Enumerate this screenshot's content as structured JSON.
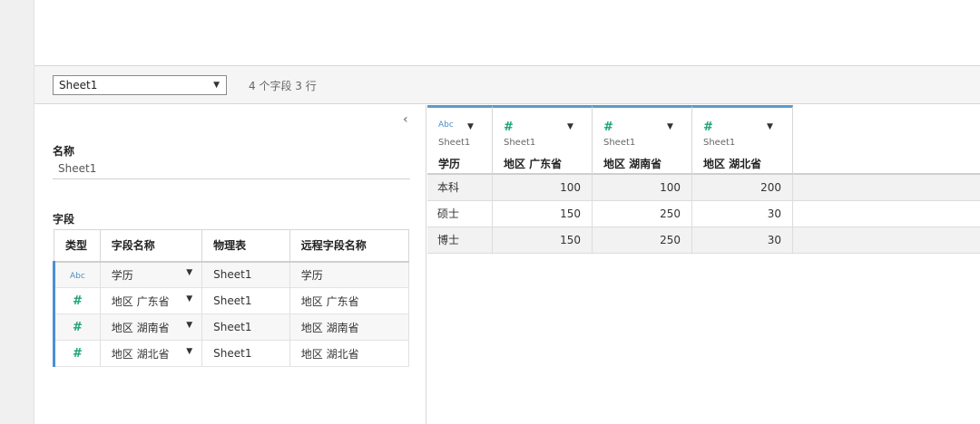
{
  "toolbar": {
    "sheet_select": "Sheet1",
    "field_count": "4 个字段 3 行"
  },
  "left_panel": {
    "collapse_glyph": "‹",
    "name_heading": "名称",
    "name_value": "Sheet1",
    "fields_heading": "字段",
    "columns": [
      "类型",
      "字段名称",
      "物理表",
      "远程字段名称"
    ],
    "rows": [
      {
        "type_icon": "abc-type-icon",
        "type": "Abc",
        "name": "学历",
        "table": "Sheet1",
        "remote": "学历"
      },
      {
        "type_icon": "number-type-icon",
        "type": "#",
        "name": "地区 广东省",
        "table": "Sheet1",
        "remote": "地区 广东省"
      },
      {
        "type_icon": "number-type-icon",
        "type": "#",
        "name": "地区 湖南省",
        "table": "Sheet1",
        "remote": "地区 湖南省"
      },
      {
        "type_icon": "number-type-icon",
        "type": "#",
        "name": "地区 湖北省",
        "table": "Sheet1",
        "remote": "地区 湖北省"
      }
    ]
  },
  "grid": {
    "columns": [
      {
        "type": "Abc",
        "source": "Sheet1",
        "name": "学历"
      },
      {
        "type": "#",
        "source": "Sheet1",
        "name": "地区 广东省"
      },
      {
        "type": "#",
        "source": "Sheet1",
        "name": "地区 湖南省"
      },
      {
        "type": "#",
        "source": "Sheet1",
        "name": "地区 湖北省"
      }
    ],
    "rows": [
      [
        "本科",
        "100",
        "100",
        "200"
      ],
      [
        "硕士",
        "150",
        "250",
        "30"
      ],
      [
        "博士",
        "150",
        "250",
        "30"
      ]
    ]
  },
  "colors": {
    "accent_blue": "#5c9bc9",
    "number_green": "#1aa37a",
    "abc_blue": "#4a8ec6"
  }
}
